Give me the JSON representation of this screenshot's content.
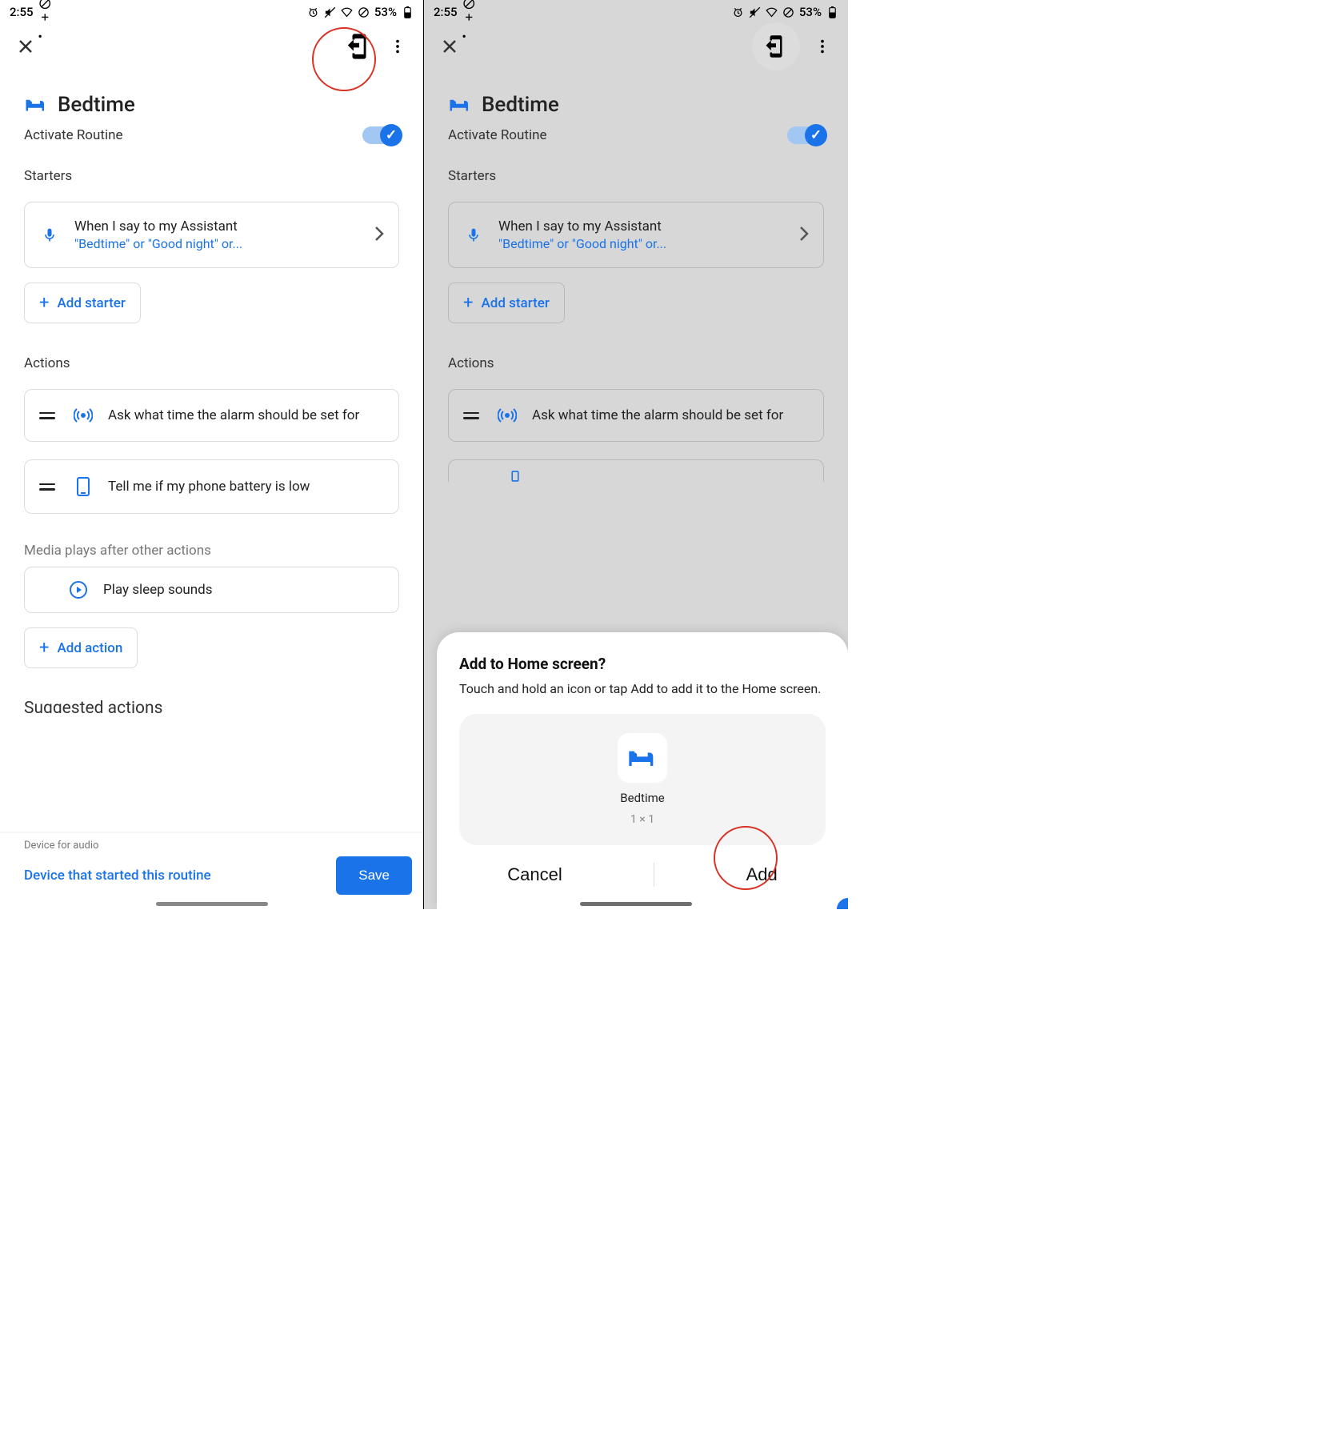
{
  "status": {
    "time": "2:55",
    "battery": "53%"
  },
  "page": {
    "title": "Bedtime",
    "activate_label": "Activate Routine"
  },
  "sections": {
    "starters": "Starters",
    "actions": "Actions",
    "media": "Media plays after other actions",
    "suggested": "Suggested actions"
  },
  "starter": {
    "title": "When I say to my Assistant",
    "subtitle": "\"Bedtime\" or \"Good night\" or...",
    "add_label": "Add starter"
  },
  "actions": {
    "alarm": "Ask what time the alarm should be set for",
    "battery": "Tell me if my phone battery is low",
    "media": "Play sleep sounds",
    "add_label": "Add action"
  },
  "footer": {
    "device_for_audio": "Device for audio",
    "device_link": "Device that started this routine",
    "save": "Save"
  },
  "sheet": {
    "title": "Add to Home screen?",
    "body": "Touch and hold an icon or tap Add to add it to the Home screen.",
    "shortcut_name": "Bedtime",
    "shortcut_dim": "1 × 1",
    "cancel": "Cancel",
    "add": "Add"
  }
}
